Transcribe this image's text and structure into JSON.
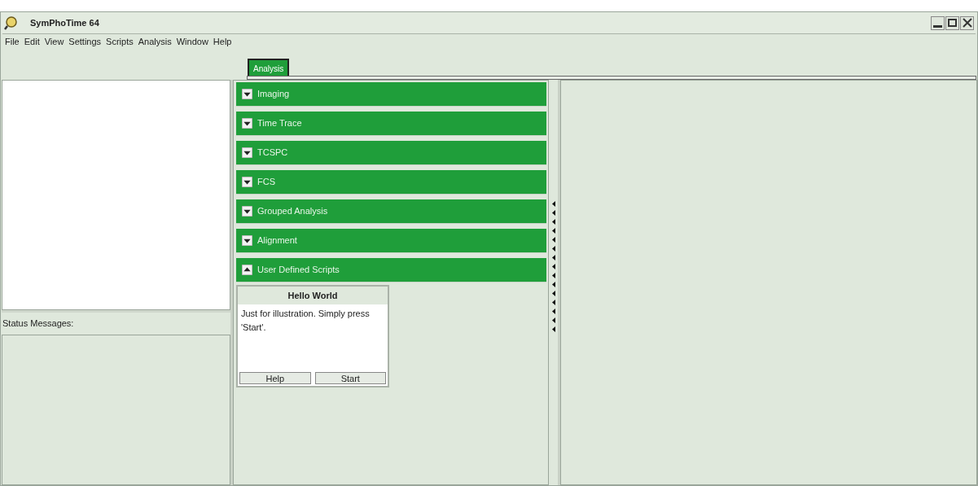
{
  "window": {
    "title": "SymPhoTime 64"
  },
  "menu": [
    "File",
    "Edit",
    "View",
    "Settings",
    "Scripts",
    "Analysis",
    "Window",
    "Help"
  ],
  "tabs": [
    {
      "label": "Analysis",
      "selected": true
    }
  ],
  "left_panel": {
    "status_label": "Status Messages:"
  },
  "sections": [
    {
      "label": "Imaging",
      "expanded": false
    },
    {
      "label": "Time Trace",
      "expanded": false
    },
    {
      "label": "TCSPC",
      "expanded": false
    },
    {
      "label": "FCS",
      "expanded": false
    },
    {
      "label": "Grouped Analysis",
      "expanded": false
    },
    {
      "label": "Alignment",
      "expanded": false
    },
    {
      "label": "User Defined Scripts",
      "expanded": true
    }
  ],
  "script_card": {
    "title": "Hello World",
    "description": "Just for illustration. Simply press 'Start'.",
    "buttons": [
      "Help",
      "Start"
    ]
  }
}
